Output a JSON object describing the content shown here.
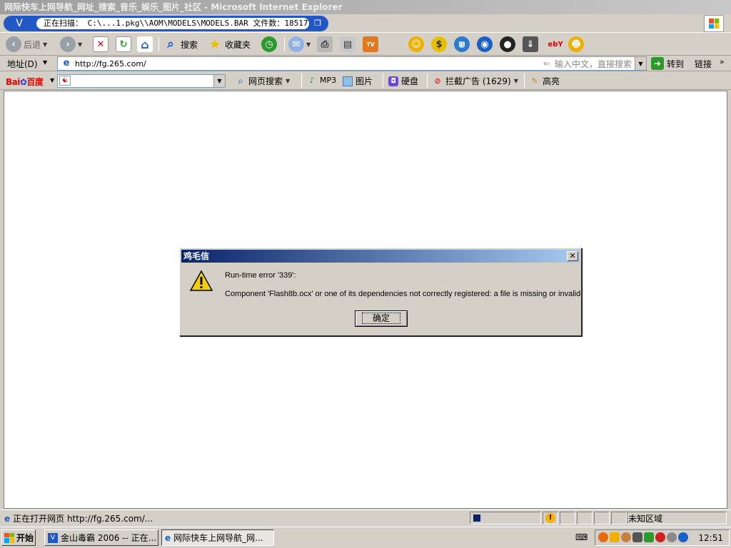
{
  "window": {
    "title": "网际快车上网导航_网址_搜索_音乐_娱乐_图片_社区 - Microsoft Internet Explorer"
  },
  "scanner": {
    "status": "正在扫描：  C:\\...1.pkg\\\\AOM\\MODELS\\MODELS.BAR 文件数：18517"
  },
  "toolbar": {
    "back_label": "后退",
    "search_label": "搜索",
    "favorites_label": "收藏夹"
  },
  "address": {
    "label": "地址(D)",
    "url": "http://fg.265.com/",
    "search_hint": "输入中文，直接搜索",
    "go_label": "转到",
    "links_label": "链接"
  },
  "baidu": {
    "logo_bai": "Bai",
    "logo_du": "百度",
    "web_search_label": "网页搜索",
    "mp3_label": "MP3",
    "images_label": "图片",
    "disk_label": "硬盘",
    "block_ads_label": "拦截广告 (1629)",
    "highlight_label": "高亮"
  },
  "dialog": {
    "title": "鸡毛信",
    "line1": "Run-time error '339':",
    "line2": "Component 'Flash8b.ocx' or one of its dependencies not correctly registered: a file is missing or invalid",
    "ok_label": "确定"
  },
  "statusbar": {
    "text": "正在打开网页 http://fg.265.com/...",
    "zone": "未知区域"
  },
  "taskbar": {
    "start_label": "开始",
    "task1": "金山毒霸 2006 -- 正在...",
    "task2": "网际快车上网导航_网...",
    "clock": "12:51"
  },
  "colors": {
    "scan_bar": "#2257c6",
    "dialog_title_start": "#0a246a",
    "dialog_title_end": "#a6caf0",
    "warning": "#f5d000"
  }
}
